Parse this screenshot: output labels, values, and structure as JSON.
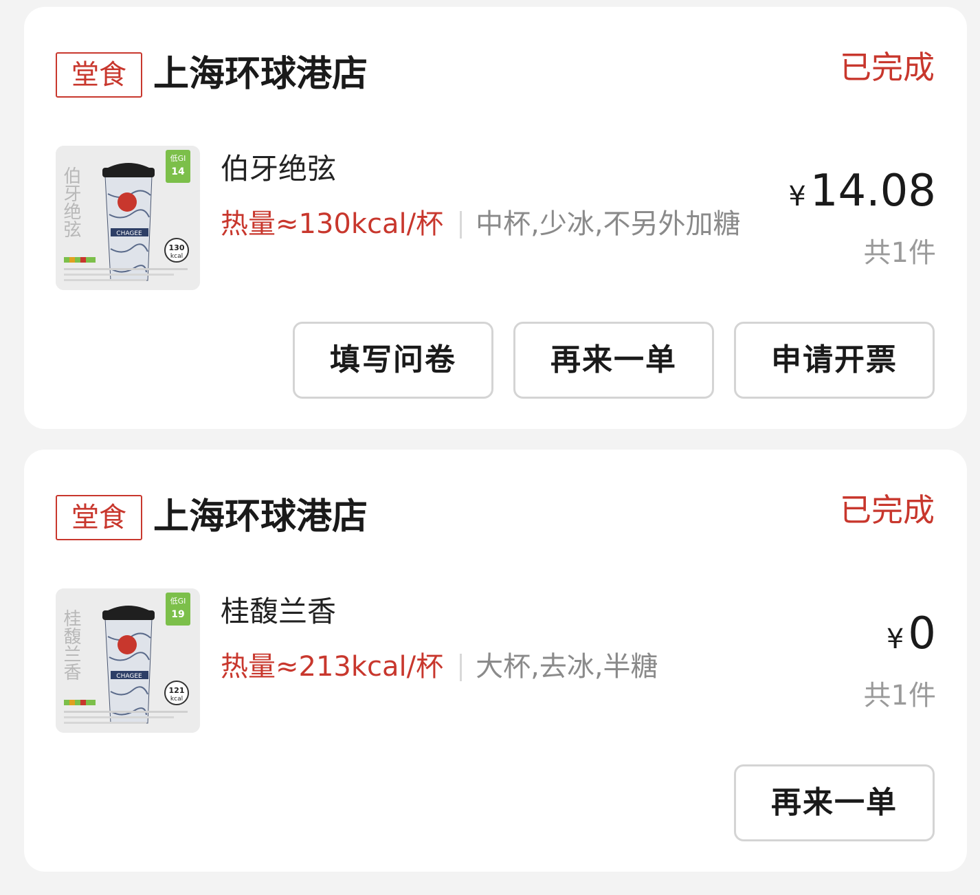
{
  "orders": [
    {
      "tag": "堂食",
      "store": "上海环球港店",
      "status": "已完成",
      "product": {
        "name": "伯牙绝弦",
        "kcal": "热量≈130kcal/杯",
        "specs": "中杯,少冰,不另外加糖",
        "image_text": "伯牙绝弦",
        "gi_label": "低GI",
        "gi_value": "14",
        "cup_kcal": "130",
        "cup_kcal_unit": "kcal",
        "brand": "CHAGEE"
      },
      "currency": "¥",
      "price": "14.08",
      "count": "共1件",
      "buttons": [
        "填写问卷",
        "再来一单",
        "申请开票"
      ]
    },
    {
      "tag": "堂食",
      "store": "上海环球港店",
      "status": "已完成",
      "product": {
        "name": "桂馥兰香",
        "kcal": "热量≈213kcal/杯",
        "specs": "大杯,去冰,半糖",
        "image_text": "桂馥兰香",
        "gi_label": "低GI",
        "gi_value": "19",
        "cup_kcal": "121",
        "cup_kcal_unit": "kcal",
        "brand": "CHAGEE"
      },
      "currency": "¥",
      "price": "0",
      "count": "共1件",
      "buttons": [
        "再来一单"
      ]
    }
  ],
  "colors": {
    "accent": "#c8372d",
    "background": "#f3f3f3",
    "card": "#ffffff",
    "gi_badge": "#7cbf4a"
  }
}
